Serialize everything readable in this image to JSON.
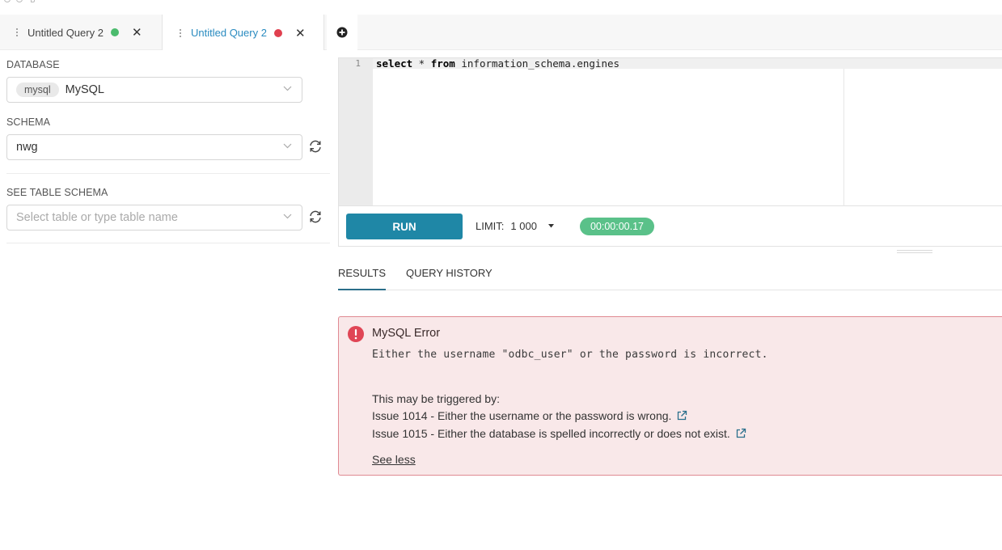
{
  "tabs": [
    {
      "title": "Untitled Query 2",
      "status_color": "#4bbb6d",
      "active": false
    },
    {
      "title": "Untitled Query 2",
      "status_color": "#e0404f",
      "active": true
    }
  ],
  "icons": {
    "tab_grip": "drag-handle-icon",
    "tab_close": "close-icon",
    "add_tab": "plus-circle-icon",
    "select_chevron": "chevron-down-icon",
    "refresh": "refresh-icon",
    "limit_caret": "caret-down-icon",
    "error": "exclamation-circle-icon",
    "external_link": "external-link-icon"
  },
  "sidebar": {
    "database": {
      "label": "DATABASE",
      "pill": "mysql",
      "value": "MySQL"
    },
    "schema": {
      "label": "SCHEMA",
      "value": "nwg"
    },
    "table_schema": {
      "label": "SEE TABLE SCHEMA",
      "placeholder": "Select table or type table name"
    }
  },
  "editor": {
    "line_numbers": [
      "1"
    ],
    "code": {
      "kw1": "select",
      "star": " * ",
      "kw2": "from",
      "rest": " information_schema.engines"
    }
  },
  "toolbar": {
    "run_label": "RUN",
    "limit_label": "LIMIT:",
    "limit_value": "1 000",
    "timer": "00:00:00.17"
  },
  "result_tabs": [
    "RESULTS",
    "QUERY HISTORY"
  ],
  "error": {
    "title": "MySQL Error",
    "message": "Either the username \"odbc_user\" or the password is incorrect.",
    "triggered_by": "This may be triggered by:",
    "issues": [
      "Issue 1014 - Either the username or the password is wrong.",
      "Issue 1015 - Either the database is spelled incorrectly or does not exist."
    ],
    "see_less": "See less"
  },
  "colors": {
    "run_button": "#1f87a6",
    "active_tab_text": "#2a8bc0",
    "timer_badge": "#5ac189",
    "error_bg": "#f9e8e9",
    "error_border": "#e08a92",
    "error_icon": "#e04555"
  }
}
